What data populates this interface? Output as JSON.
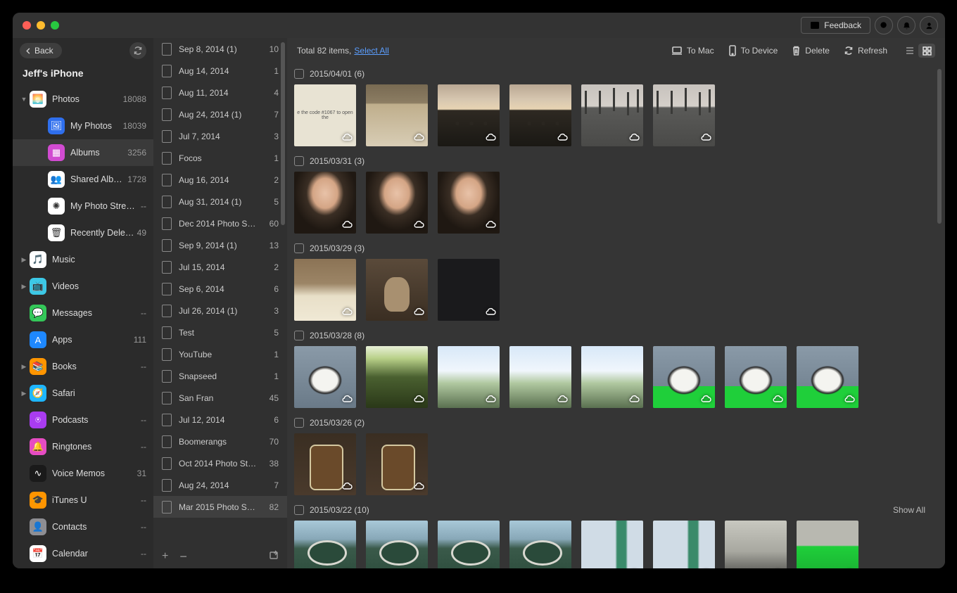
{
  "header": {
    "feedback_label": "Feedback"
  },
  "sidebar": {
    "back_label": "Back",
    "device_name": "Jeff's iPhone",
    "items": [
      {
        "label": "Photos",
        "count": "18088",
        "expandable": true,
        "expanded": true,
        "icon": "🌅",
        "bg": "#ffffff"
      },
      {
        "label": "My Photos",
        "count": "18039",
        "level": 2,
        "icon": "🖼",
        "bg": "#2f6fed"
      },
      {
        "label": "Albums",
        "count": "3256",
        "level": 2,
        "selected": true,
        "icon": "▦",
        "bg": "#d14bd1"
      },
      {
        "label": "Shared Albums",
        "count": "1728",
        "level": 2,
        "icon": "👥",
        "bg": "#ffffff"
      },
      {
        "label": "My Photo Stream",
        "count": "--",
        "level": 2,
        "icon": "✺",
        "bg": "#ffffff"
      },
      {
        "label": "Recently Deleted",
        "count": "49",
        "level": 2,
        "icon": "🗑",
        "bg": "#ffffff"
      },
      {
        "label": "Music",
        "count": "",
        "expandable": true,
        "icon": "🎵",
        "bg": "#ffffff"
      },
      {
        "label": "Videos",
        "count": "",
        "expandable": true,
        "icon": "📺",
        "bg": "#3cc8e6"
      },
      {
        "label": "Messages",
        "count": "--",
        "icon": "💬",
        "bg": "#34c759"
      },
      {
        "label": "Apps",
        "count": "111",
        "icon": "A",
        "bg": "#1e88ff"
      },
      {
        "label": "Books",
        "count": "--",
        "expandable": true,
        "icon": "📚",
        "bg": "#ff9500"
      },
      {
        "label": "Safari",
        "count": "",
        "expandable": true,
        "icon": "🧭",
        "bg": "#1eb6ff"
      },
      {
        "label": "Podcasts",
        "count": "--",
        "icon": "⍟",
        "bg": "#a93cf0"
      },
      {
        "label": "Ringtones",
        "count": "--",
        "icon": "🔔",
        "bg": "#e64cc3"
      },
      {
        "label": "Voice Memos",
        "count": "31",
        "icon": "∿",
        "bg": "#1a1a1a"
      },
      {
        "label": "iTunes U",
        "count": "--",
        "icon": "🎓",
        "bg": "#ff9500"
      },
      {
        "label": "Contacts",
        "count": "--",
        "icon": "👤",
        "bg": "#8e8e93"
      },
      {
        "label": "Calendar",
        "count": "--",
        "icon": "📅",
        "bg": "#ffffff"
      }
    ]
  },
  "albums": [
    {
      "label": "Sep 8, 2014 (1)",
      "count": "10"
    },
    {
      "label": "Aug 14, 2014",
      "count": "1"
    },
    {
      "label": "Aug 11, 2014",
      "count": "4"
    },
    {
      "label": "Aug 24, 2014 (1)",
      "count": "7"
    },
    {
      "label": "Jul 7, 2014",
      "count": "3"
    },
    {
      "label": "Focos",
      "count": "1"
    },
    {
      "label": "Aug 16, 2014",
      "count": "2"
    },
    {
      "label": "Aug 31, 2014 (1)",
      "count": "5"
    },
    {
      "label": "Dec 2014 Photo S…",
      "count": "60"
    },
    {
      "label": "Sep 9, 2014 (1)",
      "count": "13"
    },
    {
      "label": "Jul 15, 2014",
      "count": "2"
    },
    {
      "label": "Sep 6, 2014",
      "count": "6"
    },
    {
      "label": "Jul 26, 2014 (1)",
      "count": "3"
    },
    {
      "label": "Test",
      "count": "5"
    },
    {
      "label": "YouTube",
      "count": "1"
    },
    {
      "label": "Snapseed",
      "count": "1"
    },
    {
      "label": "San Fran",
      "count": "45"
    },
    {
      "label": "Jul 12, 2014",
      "count": "6"
    },
    {
      "label": "Boomerangs",
      "count": "70"
    },
    {
      "label": "Oct 2014 Photo St…",
      "count": "38"
    },
    {
      "label": "Aug 24, 2014",
      "count": "7"
    },
    {
      "label": "Mar 2015 Photo S…",
      "count": "82",
      "selected": true
    }
  ],
  "toolbar": {
    "total_prefix": "Total ",
    "total_count": "82",
    "total_suffix": " items, ",
    "select_all": "Select All",
    "to_mac": "To Mac",
    "to_device": "To Device",
    "delete": "Delete",
    "refresh": "Refresh"
  },
  "groups": [
    {
      "title": "2015/04/01 (6)",
      "thumbs": [
        "note",
        "tequila",
        "sunset",
        "sunset",
        "lot",
        "lot"
      ]
    },
    {
      "title": "2015/03/31 (3)",
      "thumbs": [
        "woman",
        "woman",
        "woman"
      ]
    },
    {
      "title": "2015/03/29 (3)",
      "thumbs": [
        "merlot",
        "cat",
        "dark"
      ]
    },
    {
      "title": "2015/03/28 (8)",
      "thumbs": [
        "dog",
        "trees",
        "sky",
        "sky",
        "sky",
        "dog-grass",
        "dog-grass",
        "dog-grass"
      ]
    },
    {
      "title": "2015/03/26 (2)",
      "thumbs": [
        "beer",
        "beer"
      ]
    },
    {
      "title": "2015/03/22 (10)",
      "show_all": "Show All",
      "thumbs": [
        "parking",
        "parking",
        "parking",
        "parking",
        "banner",
        "banner",
        "room",
        "green"
      ]
    }
  ],
  "note_text": "e the code #1067 to open the"
}
